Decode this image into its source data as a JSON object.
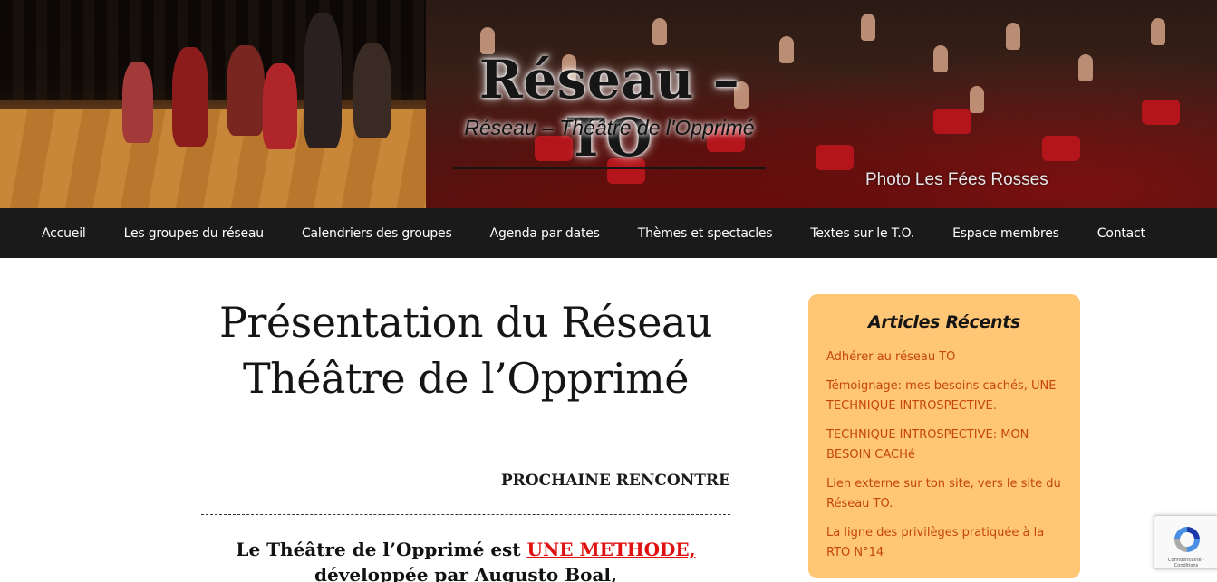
{
  "header": {
    "site_title": "Réseau – TO",
    "site_subtitle": "Réseau – Théâtre de l'Opprimé",
    "photo_credit": "Photo Les Fées Rosses"
  },
  "nav": {
    "items": [
      {
        "label": "Accueil"
      },
      {
        "label": "Les groupes du réseau"
      },
      {
        "label": "Calendriers des groupes"
      },
      {
        "label": "Agenda par dates"
      },
      {
        "label": "Thèmes et spectacles"
      },
      {
        "label": "Textes sur le T.O."
      },
      {
        "label": "Espace membres"
      },
      {
        "label": "Contact"
      }
    ]
  },
  "main": {
    "title_line1": "Présentation du Réseau",
    "title_line2": "Théâtre de l’Opprimé",
    "next_meeting": "PROCHAINE RENCONTRE",
    "intro_prefix": "Le Théâtre de l’Opprimé est ",
    "intro_accent": "UNE METHODE,",
    "intro_line2": "développée par Augusto Boal,"
  },
  "sidebar": {
    "title": "Articles Récents",
    "articles": [
      {
        "label": "Adhérer au réseau TO"
      },
      {
        "label": "Témoignage: mes besoins cachés, UNE TECHNIQUE INTROSPECTIVE."
      },
      {
        "label": "TECHNIQUE INTROSPECTIVE: MON BESOIN CACHé"
      },
      {
        "label": "Lien externe sur ton site, vers le site du Réseau TO."
      },
      {
        "label": "La ligne des privilèges pratiquée à la RTO N°14"
      }
    ]
  },
  "recaptcha": {
    "legal": "Confidentialité - Conditions",
    "icon": "recaptcha-icon"
  },
  "colors": {
    "nav_background": "#1a1a1a",
    "sidebar_background": "#ffc675",
    "sidebar_link": "#c4460a",
    "accent_red": "#e01010"
  }
}
